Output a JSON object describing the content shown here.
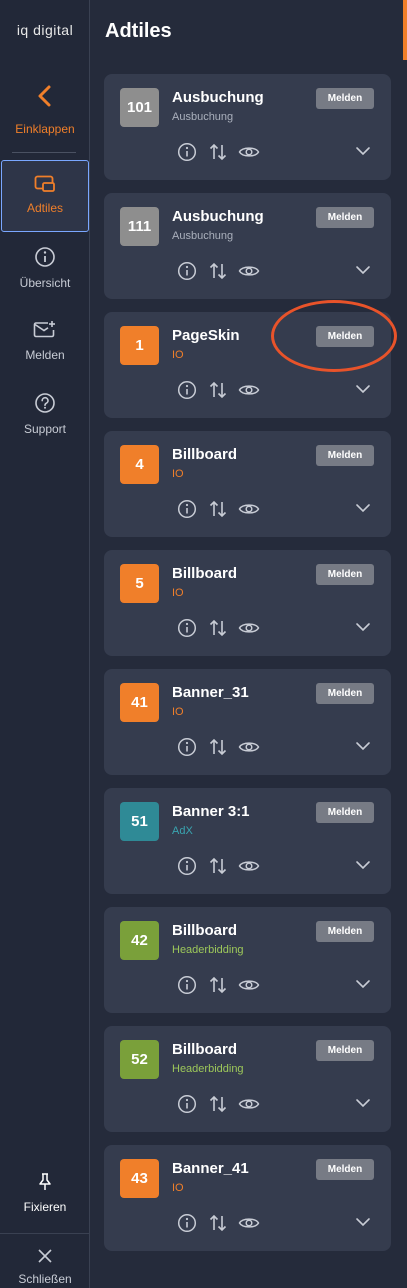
{
  "sidebar": {
    "logo": "iq digital",
    "collapse_label": "Einklappen",
    "items": [
      {
        "label": "Adtiles",
        "icon": "adtiles-icon",
        "active": true
      },
      {
        "label": "Übersicht",
        "icon": "info-icon",
        "active": false
      },
      {
        "label": "Melden",
        "icon": "mail-plus-icon",
        "active": false
      },
      {
        "label": "Support",
        "icon": "help-icon",
        "active": false
      }
    ],
    "pin_label": "Fixieren",
    "close_label": "Schließen"
  },
  "main": {
    "title": "Adtiles",
    "report_label": "Melden",
    "cards": [
      {
        "id": "101",
        "name": "Ausbuchung",
        "type": "Ausbuchung",
        "badge_color": "#8e8e8e",
        "type_color": "#aab0bc"
      },
      {
        "id": "111",
        "name": "Ausbuchung",
        "type": "Ausbuchung",
        "badge_color": "#8e8e8e",
        "type_color": "#aab0bc"
      },
      {
        "id": "1",
        "name": "PageSkin",
        "type": "IO",
        "badge_color": "#f07f2a",
        "type_color": "#f07f2a"
      },
      {
        "id": "4",
        "name": "Billboard",
        "type": "IO",
        "badge_color": "#f07f2a",
        "type_color": "#f07f2a"
      },
      {
        "id": "5",
        "name": "Billboard",
        "type": "IO",
        "badge_color": "#f07f2a",
        "type_color": "#f07f2a"
      },
      {
        "id": "41",
        "name": "Banner_31",
        "type": "IO",
        "badge_color": "#f07f2a",
        "type_color": "#f07f2a"
      },
      {
        "id": "51",
        "name": "Banner 3:1",
        "type": "AdX",
        "badge_color": "#2f8a96",
        "type_color": "#3aa5b1"
      },
      {
        "id": "42",
        "name": "Billboard",
        "type": "Headerbidding",
        "badge_color": "#7aa03a",
        "type_color": "#9dc85a"
      },
      {
        "id": "52",
        "name": "Billboard",
        "type": "Headerbidding",
        "badge_color": "#7aa03a",
        "type_color": "#9dc85a"
      },
      {
        "id": "43",
        "name": "Banner_41",
        "type": "IO",
        "badge_color": "#f07f2a",
        "type_color": "#f07f2a"
      }
    ]
  },
  "colors": {
    "accent": "#f07f2a",
    "highlight_ring": "#e8532a"
  }
}
